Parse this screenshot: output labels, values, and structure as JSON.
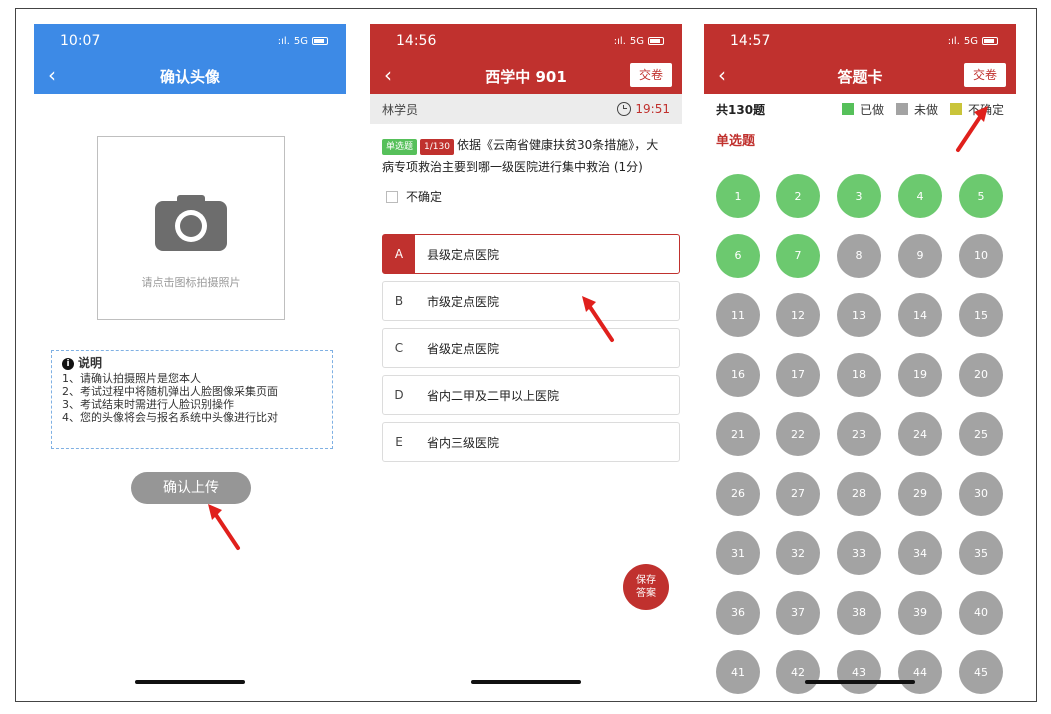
{
  "screen1": {
    "time": "10:07",
    "network": "5G",
    "title": "确认头像",
    "photo_hint": "请点击图标拍摄照片",
    "notes_title": "说明",
    "notes": [
      "1、请确认拍摄照片是您本人",
      "2、考试过程中将随机弹出人脸图像采集页面",
      "3、考试结束时需进行人脸识别操作",
      "4、您的头像将会与报名系统中头像进行比对"
    ],
    "confirm_label": "确认上传",
    "colors": {
      "header": "#3d8ae6",
      "button": "#969696"
    }
  },
  "screen2": {
    "time": "14:56",
    "network": "5G",
    "title": "西学中 901",
    "submit_label": "交卷",
    "student": "林学员",
    "timer": "19:51",
    "question_type": "单选题",
    "question_no": "1/130",
    "question_text": "依据《云南省健康扶贫30条措施》，大病专项救治主要到哪一级医院进行集中救治 (1分)",
    "uncertain_label": "不确定",
    "options": [
      {
        "letter": "A",
        "text": "县级定点医院",
        "selected": true
      },
      {
        "letter": "B",
        "text": "市级定点医院",
        "selected": false
      },
      {
        "letter": "C",
        "text": "省级定点医院",
        "selected": false
      },
      {
        "letter": "D",
        "text": "省内二甲及二甲以上医院",
        "selected": false
      },
      {
        "letter": "E",
        "text": "省内三级医院",
        "selected": false
      }
    ],
    "save_label_1": "保存",
    "save_label_2": "答案",
    "colors": {
      "header": "#c0312e"
    }
  },
  "screen3": {
    "time": "14:57",
    "network": "5G",
    "title": "答题卡",
    "submit_label": "交卷",
    "total": "共130题",
    "legend": [
      {
        "label": "已做",
        "color": "#56c05a"
      },
      {
        "label": "未做",
        "color": "#a3a3a3"
      },
      {
        "label": "不确定",
        "color": "#c9c43a"
      }
    ],
    "section": "单选题",
    "answered": [
      1,
      2,
      3,
      4,
      5,
      6,
      7
    ],
    "visible_questions": [
      1,
      2,
      3,
      4,
      5,
      6,
      7,
      8,
      9,
      10,
      11,
      12,
      13,
      14,
      15,
      16,
      17,
      18,
      19,
      20,
      21,
      22,
      23,
      24,
      25,
      26,
      27,
      28,
      29,
      30,
      31,
      32,
      33,
      34,
      35,
      36,
      37,
      38,
      39,
      40,
      41,
      42,
      43,
      44,
      45
    ],
    "colors": {
      "done": "#6cc96f",
      "undone": "#a3a3a3"
    }
  }
}
